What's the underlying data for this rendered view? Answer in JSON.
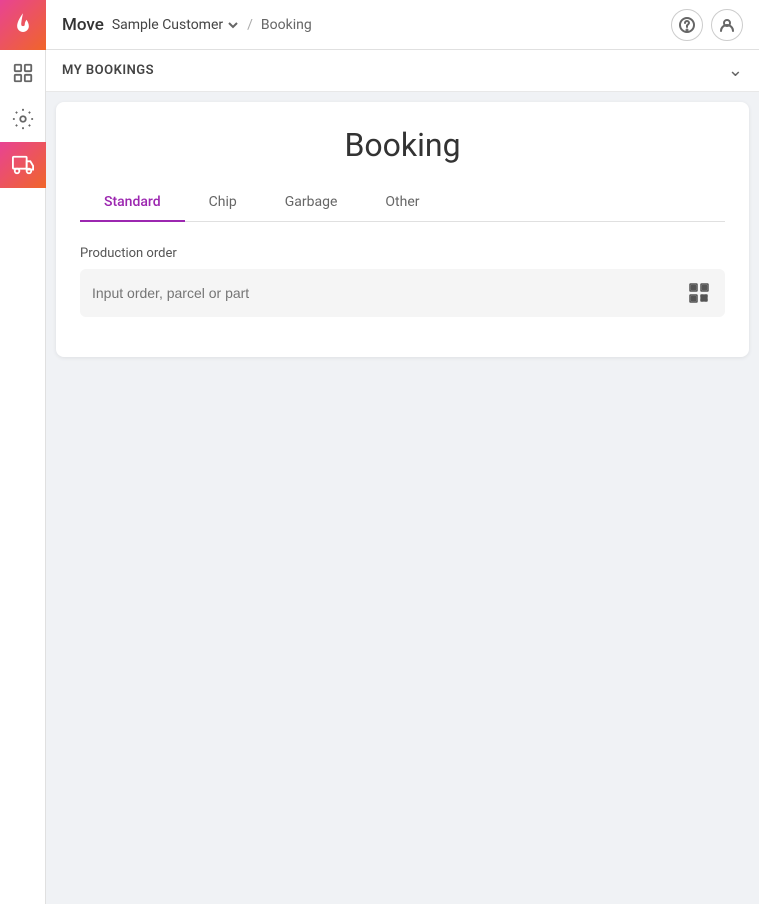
{
  "app": {
    "title": "Move",
    "logo_alt": "flame-logo"
  },
  "topbar": {
    "title": "Move",
    "customer_name": "Sample Customer",
    "separator": "/",
    "page": "Booking",
    "help_icon": "?",
    "user_icon": "user"
  },
  "sidebar": {
    "items": [
      {
        "name": "home",
        "icon": "grid",
        "active": false
      },
      {
        "name": "settings",
        "icon": "gear",
        "active": false
      },
      {
        "name": "delivery",
        "icon": "truck",
        "active": true
      }
    ]
  },
  "my_bookings": {
    "label": "MY BOOKINGS",
    "chevron": "expand"
  },
  "booking": {
    "title": "Booking",
    "tabs": [
      {
        "id": "standard",
        "label": "Standard",
        "active": true
      },
      {
        "id": "chip",
        "label": "Chip",
        "active": false
      },
      {
        "id": "garbage",
        "label": "Garbage",
        "active": false
      },
      {
        "id": "other",
        "label": "Other",
        "active": false
      }
    ],
    "production_order": {
      "label": "Production order",
      "input_placeholder": "Input order, parcel or part"
    }
  }
}
